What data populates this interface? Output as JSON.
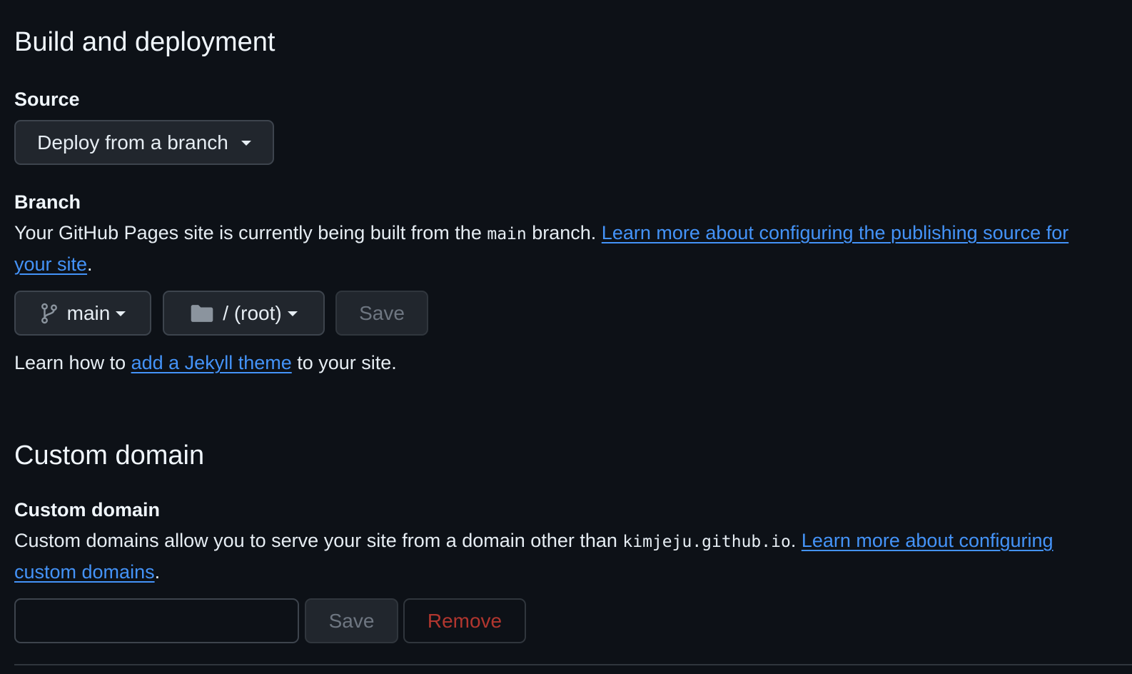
{
  "build": {
    "heading": "Build and deployment",
    "source": {
      "label": "Source",
      "dropdown_value": "Deploy from a branch"
    },
    "branch": {
      "label": "Branch",
      "desc_prefix": "Your GitHub Pages site is currently being built from the ",
      "branch_code": "main",
      "desc_middle": " branch. ",
      "link_text": "Learn more about configuring the publishing source for your site",
      "desc_suffix": ".",
      "branch_select": "main",
      "folder_select": "/ (root)",
      "save_label": "Save"
    },
    "jekyll": {
      "prefix": "Learn how to ",
      "link_text": "add a Jekyll theme",
      "suffix": " to your site."
    }
  },
  "custom_domain": {
    "heading": "Custom domain",
    "label": "Custom domain",
    "desc_prefix": "Custom domains allow you to serve your site from a domain other than ",
    "domain_code": "kimjeju.github.io",
    "desc_middle": ". ",
    "link_text": "Learn more about configuring custom domains",
    "desc_suffix": ".",
    "input_value": "",
    "save_label": "Save",
    "remove_label": "Remove"
  },
  "colors": {
    "background": "#0d1117",
    "link": "#4493f8",
    "danger": "#b1362f",
    "disabled_text": "#6e7681"
  },
  "icons": {
    "branch": "git-branch-icon",
    "folder": "folder-icon",
    "caret": "triangle-down-icon"
  }
}
